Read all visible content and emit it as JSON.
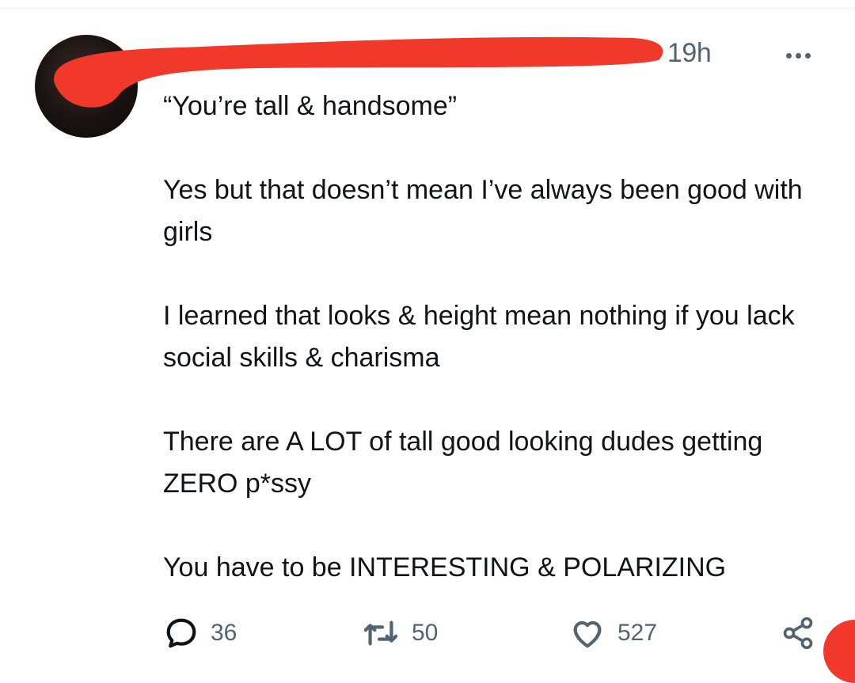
{
  "tweet": {
    "timestamp": "19h",
    "paragraphs": [
      "“You’re tall & handsome”",
      "Yes but that doesn’t mean I’ve always been good with girls",
      "I learned that looks & height mean nothing if you lack social skills & charisma",
      "There are A LOT of tall good looking dudes getting ZERO p*ssy",
      "You have to be INTERESTING & POLARIZING"
    ]
  },
  "actions": {
    "replies": "36",
    "reposts": "50",
    "likes": "527"
  },
  "icons": {
    "more": "more-horizontal-icon",
    "reply": "speech-bubble-icon",
    "repost": "repost-arrows-icon",
    "like": "heart-icon",
    "share": "share-nodes-icon"
  },
  "colors": {
    "text": "#0f1419",
    "secondary": "#536471",
    "redaction": "#f0392b"
  }
}
